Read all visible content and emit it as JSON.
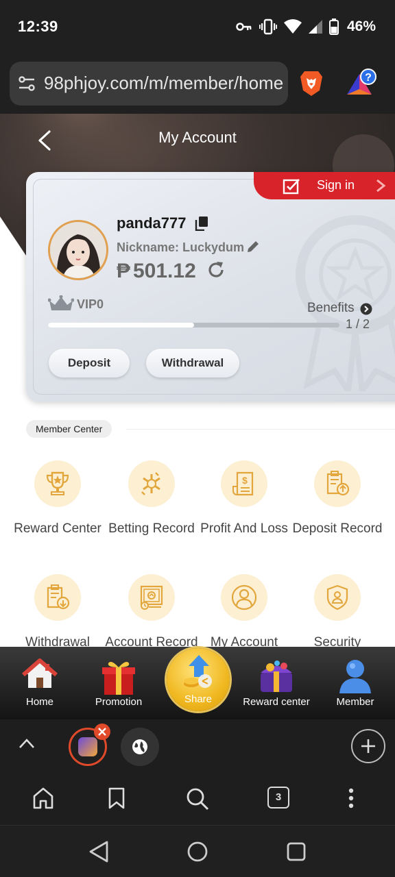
{
  "status_bar": {
    "time": "12:39",
    "battery": "46%"
  },
  "browser": {
    "url": "98phjoy.com/m/member/home",
    "tab_count": "3"
  },
  "header": {
    "title": "My Account"
  },
  "account_card": {
    "sign_in_label": "Sign in",
    "username": "panda777",
    "nickname": "Nickname: Luckydum",
    "currency_symbol": "₱",
    "balance": "501.12",
    "vip_level": "VIP0",
    "benefits_label": "Benefits",
    "progress_count": "1 / 2",
    "progress_fraction": 0.5,
    "deposit_label": "Deposit",
    "withdrawal_label": "Withdrawal"
  },
  "member_center": {
    "title": "Member Center",
    "items": [
      {
        "label": "Reward Center",
        "icon": "trophy-icon"
      },
      {
        "label": "Betting Record",
        "icon": "betting-record-icon"
      },
      {
        "label": "Profit And Loss",
        "icon": "profit-loss-icon"
      },
      {
        "label": "Deposit Record",
        "icon": "deposit-record-icon"
      },
      {
        "label": "Withdrawal",
        "icon": "withdrawal-record-icon"
      },
      {
        "label": "Account Record",
        "icon": "account-record-icon"
      },
      {
        "label": "My Account",
        "icon": "user-icon"
      },
      {
        "label": "Security",
        "icon": "security-shield-icon"
      }
    ]
  },
  "bottom_nav": {
    "home": "Home",
    "promotion": "Promotion",
    "share": "Share",
    "reward_center": "Reward center",
    "member": "Member"
  },
  "colors": {
    "accent_red": "#d9232a",
    "gold": "#f0b820",
    "icon_orange": "#e2a63c",
    "icon_bg": "#fcefd2"
  }
}
